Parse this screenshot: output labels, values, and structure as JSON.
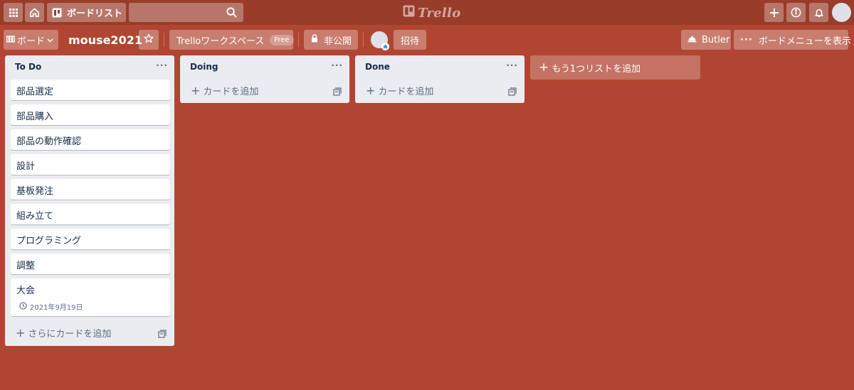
{
  "header": {
    "apps_icon": "grid-icon",
    "home_icon": "home-icon",
    "boards_label": "ボードリスト",
    "search_icon": "search-icon",
    "brand": "Trello",
    "create_icon": "plus-icon",
    "info_icon": "info-icon",
    "notifications_icon": "bell-icon"
  },
  "board_header": {
    "view_switcher_label": "ボード",
    "title": "mouse2021",
    "workspace_label": "Trelloワークスペース",
    "workspace_badge": "Free",
    "visibility_label": "非公開",
    "invite_label": "招待",
    "butler_label": "Butler",
    "menu_label": "ボードメニューを表示"
  },
  "lists": [
    {
      "title": "To Do",
      "menu": "···",
      "cards": [
        {
          "title": "部品選定"
        },
        {
          "title": "部品購入"
        },
        {
          "title": "部品の動作確認"
        },
        {
          "title": "設計"
        },
        {
          "title": "基板発注"
        },
        {
          "title": "組み立て"
        },
        {
          "title": "プログラミング"
        },
        {
          "title": "調整"
        },
        {
          "title": "大会",
          "due": "2021年9月19日"
        }
      ],
      "add_label": "さらにカードを追加"
    },
    {
      "title": "Doing",
      "menu": "···",
      "cards": [],
      "add_label": "カードを追加"
    },
    {
      "title": "Done",
      "menu": "···",
      "cards": [],
      "add_label": "カードを追加"
    }
  ],
  "add_list_label": "もう1つリストを追加",
  "colors": {
    "board_background": "#b04632",
    "header_background": "#9a3c2a",
    "list_background": "#ebecf0"
  }
}
